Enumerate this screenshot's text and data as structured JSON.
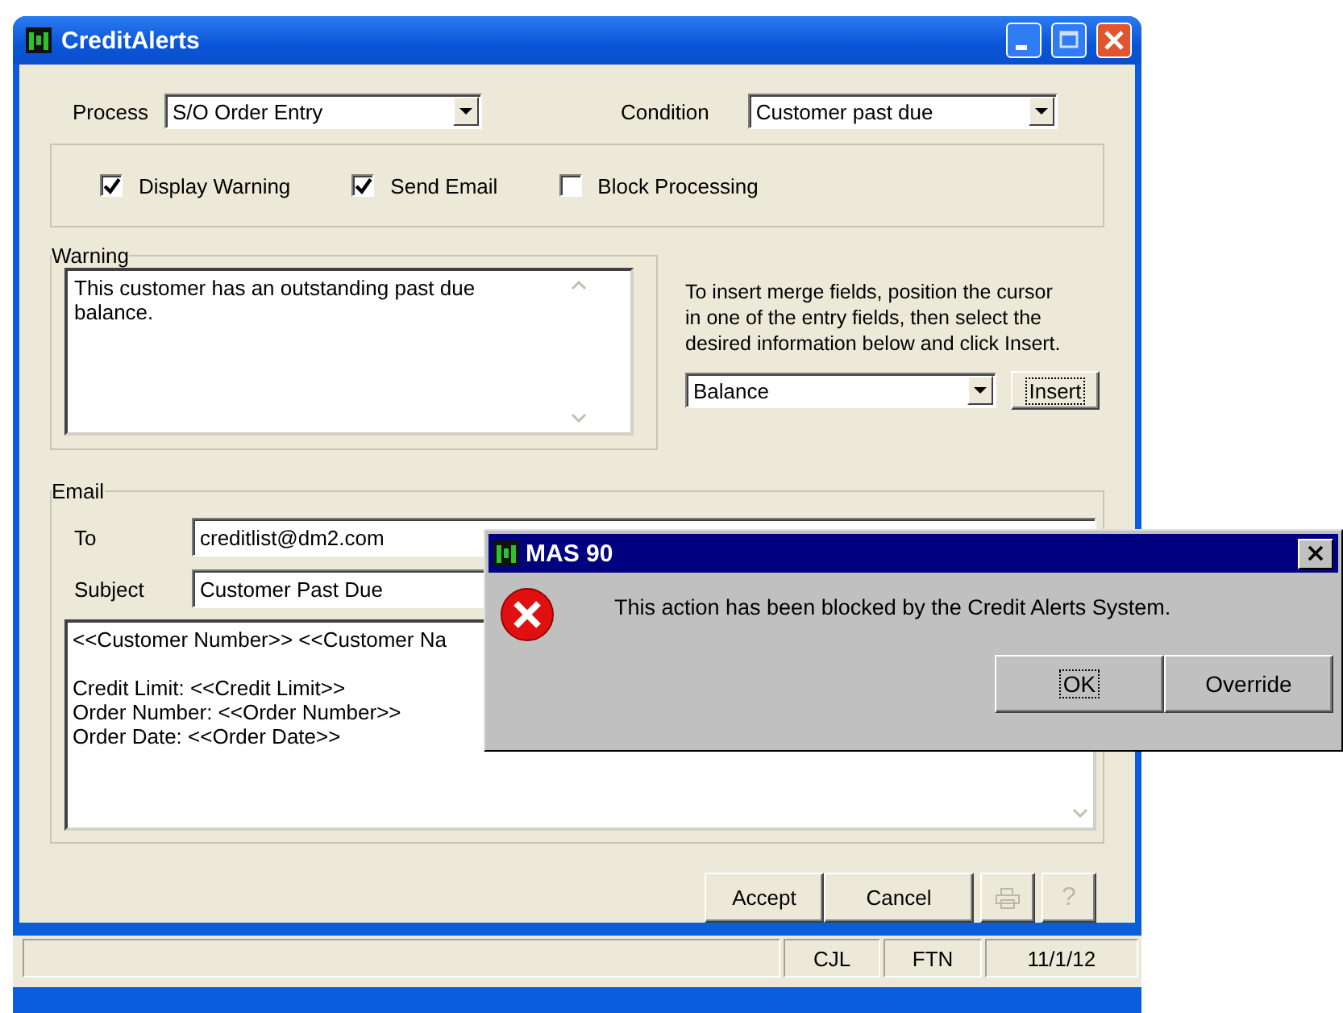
{
  "window": {
    "title": "CreditAlerts"
  },
  "process": {
    "label": "Process",
    "value": "S/O Order Entry"
  },
  "condition": {
    "label": "Condition",
    "value": "Customer past due"
  },
  "options": [
    {
      "label": "Display Warning",
      "checked": true
    },
    {
      "label": "Send Email",
      "checked": true
    },
    {
      "label": "Block Processing",
      "checked": false
    }
  ],
  "warning": {
    "legend": "Warning",
    "text": "This customer has an outstanding past due balance."
  },
  "merge_help": "To insert merge fields, position the cursor in one of the entry fields, then select the desired information below and click Insert.",
  "merge_field": {
    "value": "Balance"
  },
  "insert_button": {
    "label": "Insert",
    "focused": true
  },
  "email": {
    "legend": "Email",
    "to_label": "To",
    "to": "creditlist@dm2.com",
    "subject_label": "Subject",
    "subject": "Customer Past Due",
    "body": [
      [
        "<<Customer Number>> <<Customer Na"
      ],
      [
        "Credit Limit: <<Credit Limit>>",
        "Order Number: <<Order Number>>",
        "Order Date: <<Order Date>>"
      ]
    ]
  },
  "buttons": [
    {
      "label": "Accept"
    },
    {
      "label": "Cancel"
    }
  ],
  "print_button": {
    "disabled": true
  },
  "help_button": {
    "label": "?",
    "disabled": true
  },
  "status_bar": {
    "panes": [
      "CJL",
      "FTN",
      "11/1/12"
    ]
  },
  "dialog": {
    "title": "MAS 90",
    "message": "This action has been blocked by the Credit Alerts System.",
    "buttons": [
      {
        "label": "OK",
        "focused": true
      },
      {
        "label": "Override",
        "focused": false
      }
    ]
  }
}
